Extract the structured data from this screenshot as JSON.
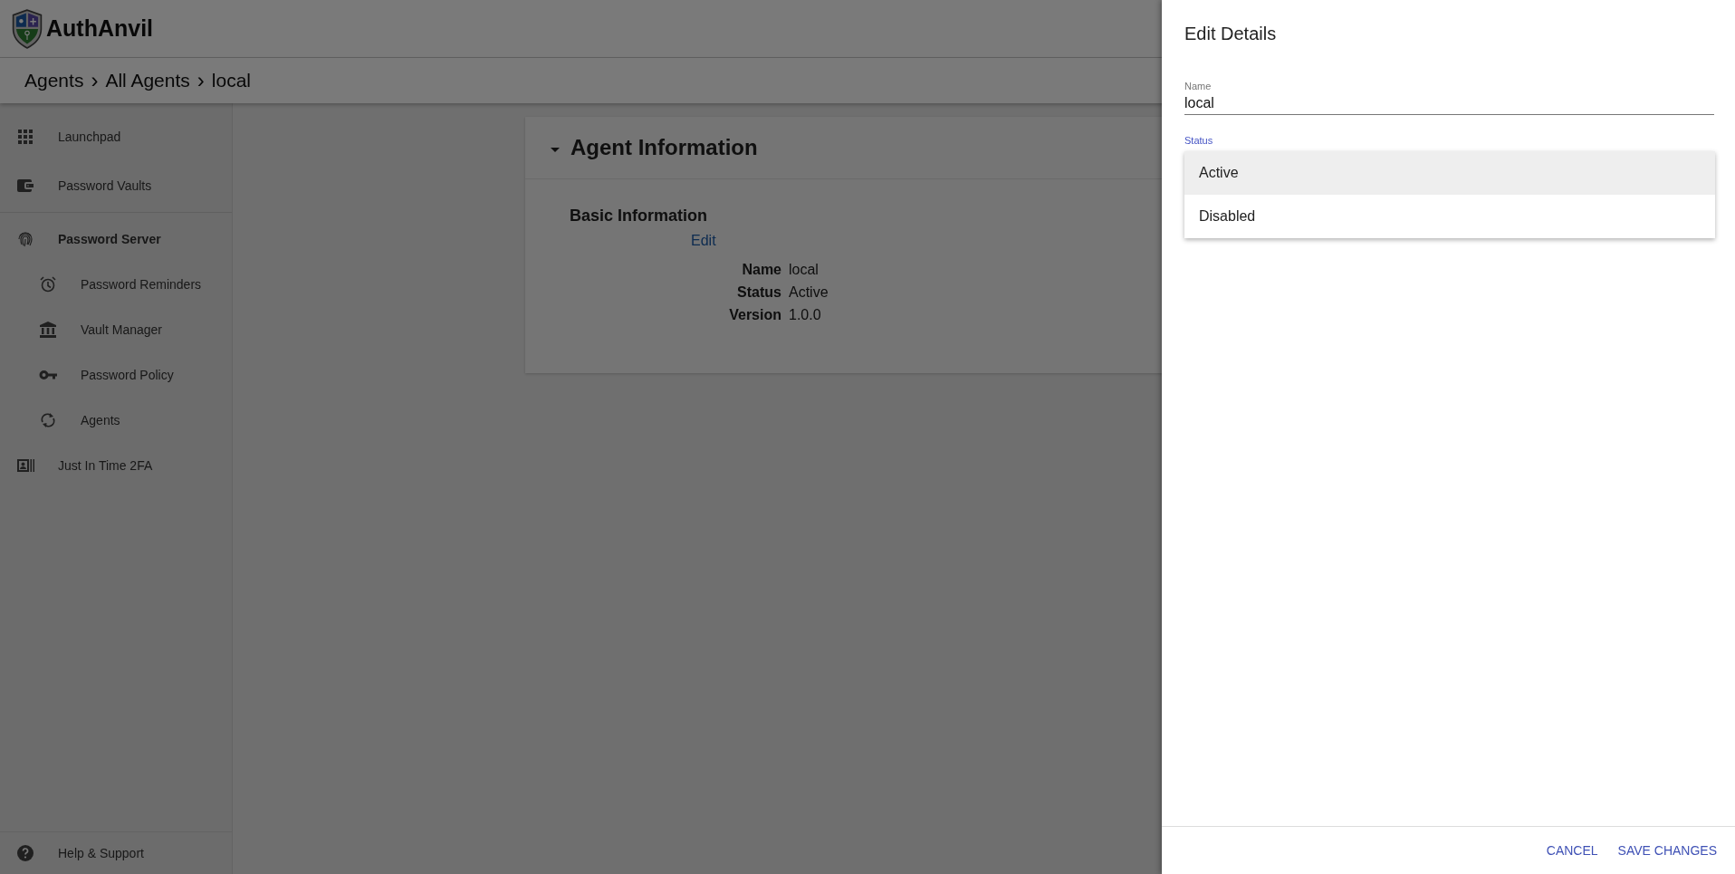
{
  "header": {
    "logo_text": "AuthAnvil"
  },
  "breadcrumb": [
    "Agents",
    "All Agents",
    "local"
  ],
  "breadcrumb_separator": "›",
  "sidebar": {
    "items": [
      {
        "label": "Launchpad",
        "expanded": false
      },
      {
        "label": "Password Vaults",
        "expanded": false
      },
      {
        "label": "Password Server",
        "expanded": true,
        "children": [
          {
            "label": "Password Reminders"
          },
          {
            "label": "Vault Manager"
          },
          {
            "label": "Password Policy"
          },
          {
            "label": "Agents"
          }
        ]
      },
      {
        "label": "Just In Time 2FA",
        "expanded": false
      }
    ],
    "footer": {
      "label": "Help & Support"
    }
  },
  "card": {
    "title": "Agent Information",
    "expanded": true,
    "section": "Basic Information",
    "edit_link": "Edit",
    "fields": [
      {
        "label": "Name",
        "value": "local"
      },
      {
        "label": "Status",
        "value": "Active"
      },
      {
        "label": "Version",
        "value": "1.0.0"
      }
    ]
  },
  "drawer": {
    "title": "Edit Details",
    "name_field": {
      "label": "Name",
      "value": "local"
    },
    "status_field": {
      "label": "Status",
      "focused": true
    },
    "status_options": [
      {
        "label": "Active",
        "selected": true
      },
      {
        "label": "Disabled",
        "selected": false
      }
    ],
    "buttons": [
      "CANCEL",
      "SAVE CHANGES"
    ]
  }
}
